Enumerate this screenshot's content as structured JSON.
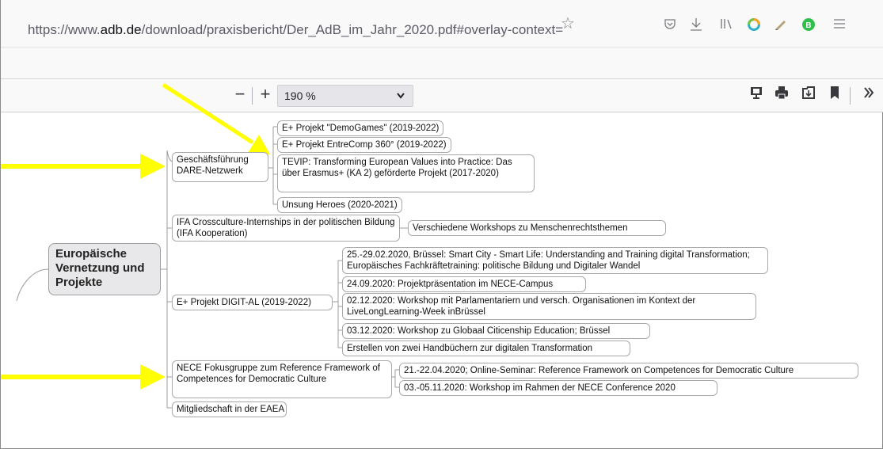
{
  "browser": {
    "url_prefix": "https://www.",
    "url_host": "adb.de",
    "url_path": "/download/praxisbericht/Der_AdB_im_Jahr_2020.pdf#overlay-context=co",
    "profile_badge": "B"
  },
  "pdf_toolbar": {
    "zoom_value": "190 %"
  },
  "colors": {
    "arrow": "#ffff00",
    "root_bg": "#e8e8ea",
    "node_border": "#a9a9a9"
  },
  "mindmap": {
    "root": "Europäische Vernetzung und Projekte",
    "branches": [
      {
        "label": "Geschäftsführung DARE-Netzwerk",
        "children": [
          "E+ Projekt \"DemoGames\" (2019-2022)",
          "E+ Projekt EntreComp 360° (2019-2022)",
          "TEVIP: Transforming European Values into Practice: Das über Erasmus+ (KA 2) geförderte Projekt (2017-2020)",
          "Unsung Heroes (2020-2021)"
        ]
      },
      {
        "label": "IFA Crossculture-Internships in der politischen Bildung  (IFA Kooperation)",
        "children": [
          "Verschiedene Workshops zu Menschenrechtsthemen"
        ]
      },
      {
        "label": "E+ Projekt DIGIT-AL (2019-2022)",
        "children": [
          "25.-29.02.2020, Brüssel: Smart City - Smart Life: Understanding and Training digital Transformation; Europäisches Fachkräftetraining: politische Bildung und Digitaler Wandel",
          "24.09.2020: Projektpräsentation im NECE-Campus",
          "02.12.2020: Workshop mit Parlamentariern und versch. Organisationen im Kontext der LiveLongLearning-Week inBrüssel",
          "03.12.2020: Workshop zu Globaal Citicenship Education; Brüssel",
          "Erstellen von zwei Handbüchern zur digitalen Transformation"
        ]
      },
      {
        "label": "NECE Fokusgruppe zum Reference Framework of Competences for Democratic Culture",
        "children": [
          "21.-22.04.2020; Online-Seminar: Reference Framework on Competences for Democratic Culture",
          "03.-05.11.2020: Workshop im Rahmen der NECE Conference 2020"
        ]
      },
      {
        "label": "Mitgliedschaft in der EAEA",
        "children": []
      }
    ]
  }
}
